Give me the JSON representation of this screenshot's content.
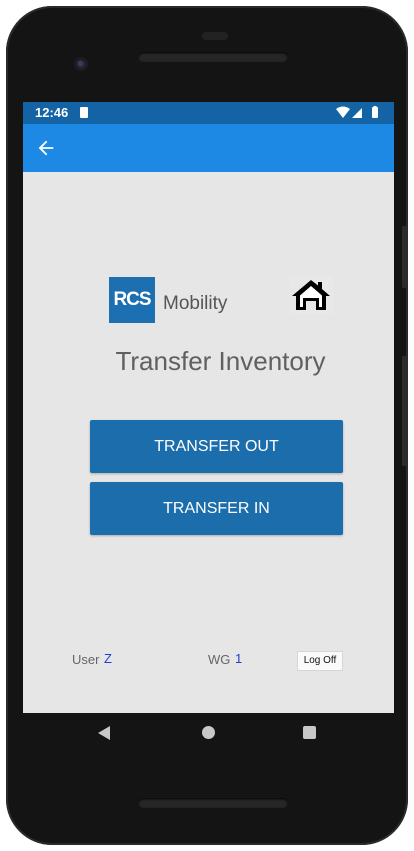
{
  "status_bar": {
    "time": "12:46",
    "icons": [
      "sd-card-icon",
      "wifi-icon",
      "cell-signal-icon",
      "battery-icon"
    ]
  },
  "app_bar": {
    "back_icon": "arrow-back-icon",
    "color": "#1e88e5"
  },
  "logo": {
    "mark": "RCS",
    "text": "Mobility"
  },
  "home_icon": "home-icon",
  "title": "Transfer Inventory",
  "buttons": {
    "transfer_out": "TRANSFER OUT",
    "transfer_in": "TRANSFER IN"
  },
  "footer": {
    "user_label": "User",
    "user_value": "Z",
    "wg_label": "WG",
    "wg_value": "1",
    "logoff_label": "Log Off"
  },
  "nav": {
    "icons": [
      "nav-back-icon",
      "nav-home-icon",
      "nav-recents-icon"
    ]
  },
  "colors": {
    "status_bar": "#1464a5",
    "button": "#1b6dab",
    "background": "#e6e6e6"
  }
}
